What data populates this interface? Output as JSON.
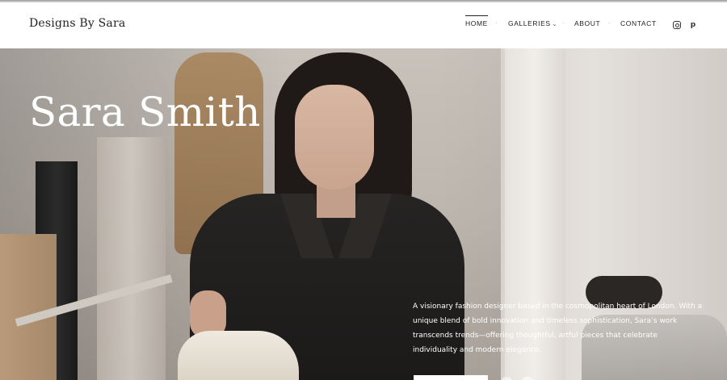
{
  "header": {
    "brand": "Designs By Sara",
    "nav": {
      "home": "HOME",
      "galleries": "GALLERIES",
      "about": "ABOUT",
      "contact": "CONTACT"
    },
    "separator": "·",
    "galleries_chevron": "⌄",
    "social": {
      "instagram_icon": "instagram-icon",
      "pinterest_icon": "pinterest-icon",
      "pinterest_glyph": "p"
    }
  },
  "hero": {
    "title": "Sara Smith",
    "description": "A visionary fashion designer based in the cosmopolitan heart of London. With a unique blend of bold innovation and timeless sophistication, Sara’s work transcends trends—offering thoughtful, artful pieces that celebrate individuality and modern elegance."
  },
  "colors": {
    "text_dark": "#222222",
    "white": "#ffffff",
    "separator": "#b0b0b0"
  }
}
